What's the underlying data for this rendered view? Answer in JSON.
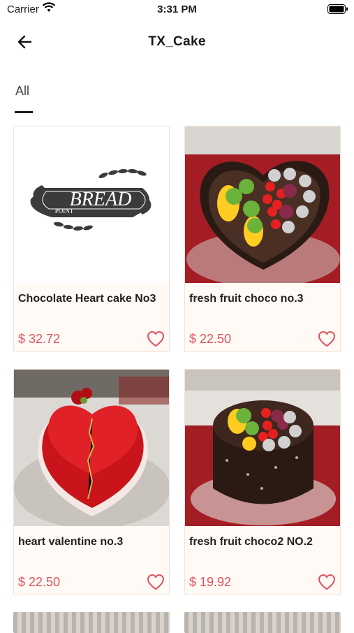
{
  "status_bar": {
    "carrier": "Carrier",
    "time": "3:31 PM"
  },
  "nav": {
    "title": "TX_Cake",
    "back_icon": "arrow-left-icon"
  },
  "tabs": [
    {
      "label": "All",
      "selected": true
    }
  ],
  "products": [
    {
      "name": "Chocolate Heart cake No3",
      "price": "$ 32.72",
      "image": "bread-point-logo",
      "logo_text_1": "BREAD",
      "logo_text_2": "POINT"
    },
    {
      "name": "fresh fruit choco no.3",
      "price": "$ 22.50",
      "image": "heart-chocolate-fruit-cake"
    },
    {
      "name": "heart valentine no.3",
      "price": "$ 22.50",
      "image": "red-heart-valentine-cake"
    },
    {
      "name": "fresh fruit choco2 NO.2",
      "price": "$ 19.92",
      "image": "round-chocolate-fruit-cake"
    }
  ],
  "colors": {
    "price": "#e0525b",
    "heart": "#e0525b",
    "card_bg": "#fffaf6",
    "card_border": "#f4e3d6"
  }
}
